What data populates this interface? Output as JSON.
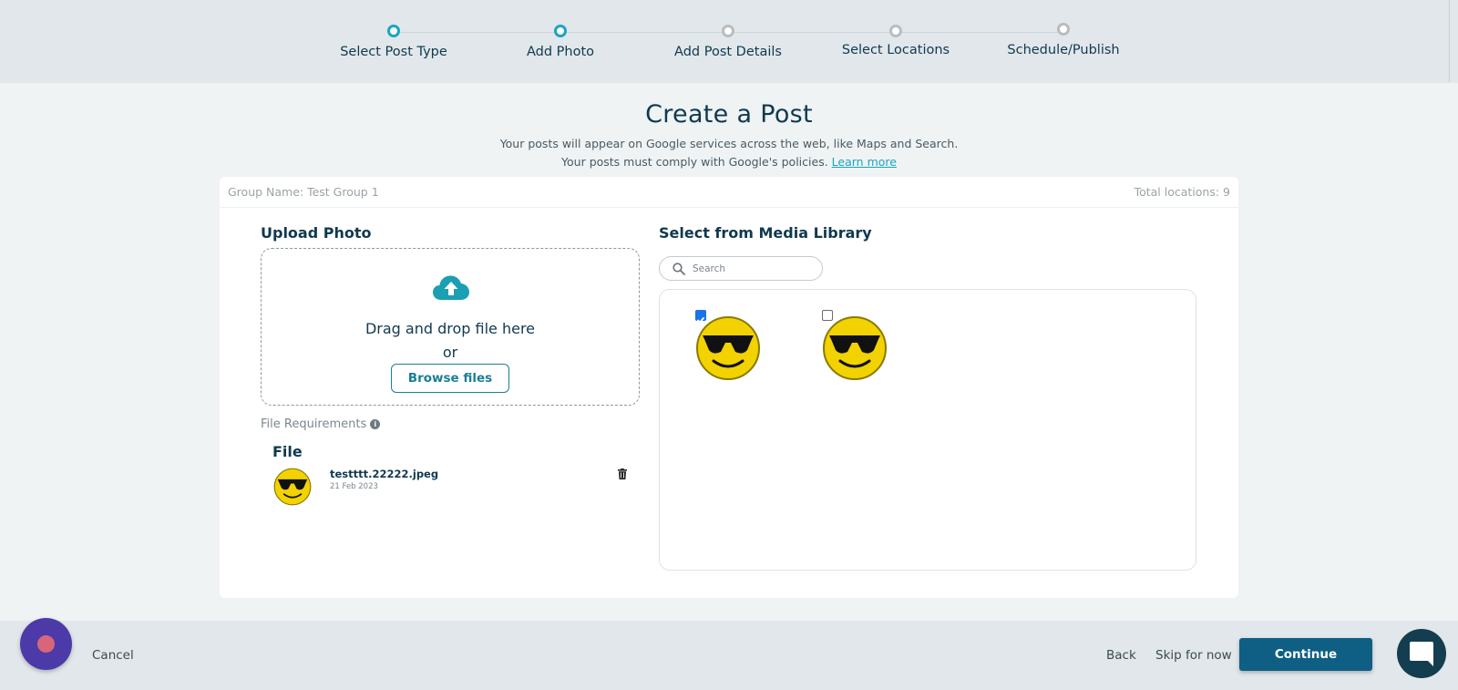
{
  "stepper": {
    "steps": [
      {
        "label": "Select Post Type",
        "state": "active"
      },
      {
        "label": "Add Photo",
        "state": "active"
      },
      {
        "label": "Add Post Details",
        "state": "inactive"
      },
      {
        "label": "Select Locations",
        "state": "inactive"
      },
      {
        "label": "Schedule/Publish",
        "state": "inactive"
      }
    ]
  },
  "header": {
    "title": "Create a Post",
    "subtitle_line1": "Your posts will appear on Google services across the web, like Maps and Search.",
    "subtitle_line2": "Your posts must comply with Google's policies.",
    "learn_more": "Learn more"
  },
  "card": {
    "group_name": "Group Name: Test Group 1",
    "total_locations": "Total locations: 9"
  },
  "upload": {
    "title": "Upload Photo",
    "drag_text": "Drag and drop file here",
    "or_text": "or",
    "browse_label": "Browse files",
    "file_requirements": "File Requirements",
    "file_heading": "File",
    "file": {
      "name": "testttt.22222.jpeg",
      "date": "21 Feb 2023"
    }
  },
  "media": {
    "title": "Select from Media Library",
    "search_placeholder": "Search",
    "items": [
      {
        "checked": true,
        "icon": "sunglasses-smiley-icon"
      },
      {
        "checked": false,
        "icon": "sunglasses-smiley-icon"
      }
    ]
  },
  "footer": {
    "cancel": "Cancel",
    "back": "Back",
    "skip": "Skip for now",
    "continue": "Continue"
  },
  "colors": {
    "accent": "#1ba5c1",
    "primary_button": "#0f5f85",
    "heading_text": "#10394f",
    "assistant_button": "#4b3aa8"
  }
}
